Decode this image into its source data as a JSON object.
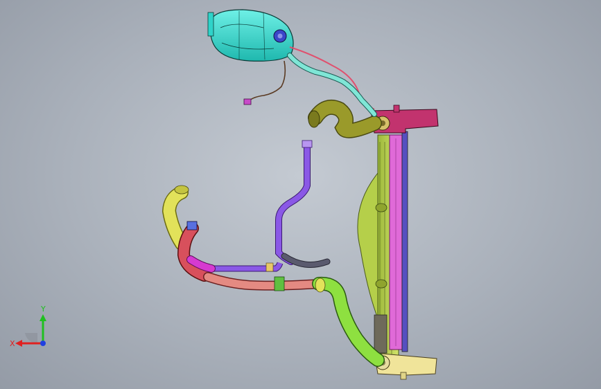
{
  "viewport": {
    "background_top": "#c4cad2",
    "background_bottom": "#949ba6"
  },
  "parts": [
    {
      "name": "expansion-tank",
      "color": "#2fd3c9"
    },
    {
      "name": "tank-cap",
      "color": "#3a46c8"
    },
    {
      "name": "overflow-hose",
      "color": "#7fe6d6"
    },
    {
      "name": "vent-line",
      "color": "#e0506e"
    },
    {
      "name": "sensor-wire",
      "color": "#5a3a22"
    },
    {
      "name": "sensor-connector",
      "color": "#c84ac8"
    },
    {
      "name": "upper-radiator-hose",
      "color": "#9a9a2a"
    },
    {
      "name": "fan-shroud",
      "color": "#b5cf4a"
    },
    {
      "name": "radiator-core",
      "color": "#e06ad8"
    },
    {
      "name": "radiator-tank",
      "color": "#5650c0"
    },
    {
      "name": "radiator-bracket-top",
      "color": "#c2336e"
    },
    {
      "name": "radiator-bracket-bottom",
      "color": "#f0e49a"
    },
    {
      "name": "purple-pipe",
      "color": "#8a58e6"
    },
    {
      "name": "yellow-hose",
      "color": "#e2e25a"
    },
    {
      "name": "red-hose",
      "color": "#d8505c"
    },
    {
      "name": "magenta-pipe",
      "color": "#d63ad0"
    },
    {
      "name": "salmon-pipe",
      "color": "#e48a82"
    },
    {
      "name": "green-hose",
      "color": "#8ee040"
    },
    {
      "name": "gray-hose",
      "color": "#5a5a6e"
    }
  ],
  "triad": {
    "x_label": "X",
    "y_label": "Y",
    "x_color": "#e02020",
    "y_color": "#20c020",
    "z_color": "#2040e0"
  }
}
